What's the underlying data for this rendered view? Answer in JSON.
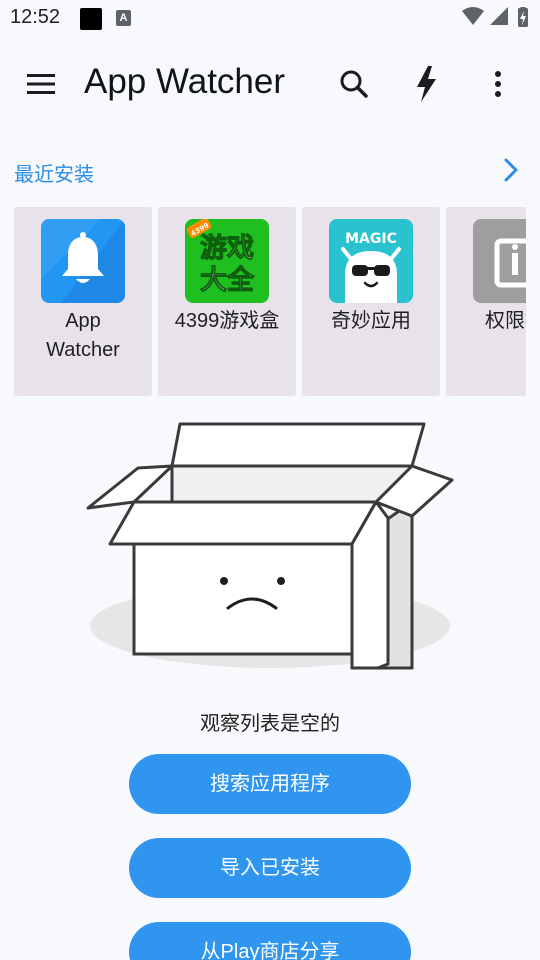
{
  "status_bar": {
    "time": "12:52",
    "notif_text": "A"
  },
  "app_bar": {
    "title": "App Watcher",
    "icons": [
      "menu-icon",
      "search-icon",
      "bolt-icon",
      "more-vert-icon"
    ]
  },
  "recent": {
    "title": "最近安装",
    "apps": [
      {
        "name": "App\nWatcher",
        "icon": "bell-icon",
        "color": "#2196f3"
      },
      {
        "name": "4399游戏盒",
        "icon": "game-box-icon",
        "color": "#1fbf1f",
        "icon_text_top": "游戏",
        "icon_text_bottom": "大全",
        "icon_badge": "4399"
      },
      {
        "name": "奇妙应用",
        "icon": "magic-icon",
        "color": "#2bc2cf",
        "icon_text": "MAGIC"
      },
      {
        "name": "权限控",
        "icon": "permission-icon",
        "color": "#9e9e9e"
      }
    ]
  },
  "empty_state": {
    "message": "观察列表是空的"
  },
  "actions": {
    "search": "搜索应用程序",
    "import": "导入已安装",
    "share": "从Play商店分享"
  },
  "colors": {
    "accent": "#2e8de6",
    "button": "#2f95ee",
    "card": "#e8e3ea",
    "background": "#f8f9fc"
  }
}
